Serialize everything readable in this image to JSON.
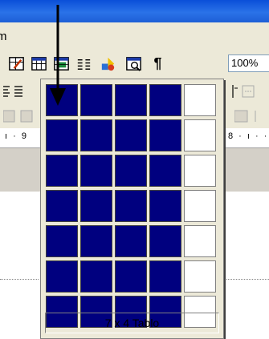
{
  "menubar": {
    "partial_label": "m"
  },
  "toolbar": {
    "zoom_value": "100%",
    "pilcrow": "¶",
    "buttons": [
      {
        "name": "tables-and-borders-icon"
      },
      {
        "name": "insert-table-icon"
      },
      {
        "name": "insert-excel-worksheet-icon"
      },
      {
        "name": "columns-icon"
      },
      {
        "name": "drawing-icon"
      },
      {
        "name": "document-map-icon"
      },
      {
        "name": "show-hide-formatting-icon"
      }
    ]
  },
  "ruler": {
    "left_text": "ı · 9",
    "right_text": "8 · ı · ·"
  },
  "table_picker": {
    "rows": 7,
    "columns": 5,
    "selected_rows": 7,
    "selected_columns": 4,
    "status_label": "7 x 4 Tablo"
  },
  "colors": {
    "selection": "#00007f",
    "title": "#0a4fd8",
    "chrome": "#ece9d8"
  }
}
